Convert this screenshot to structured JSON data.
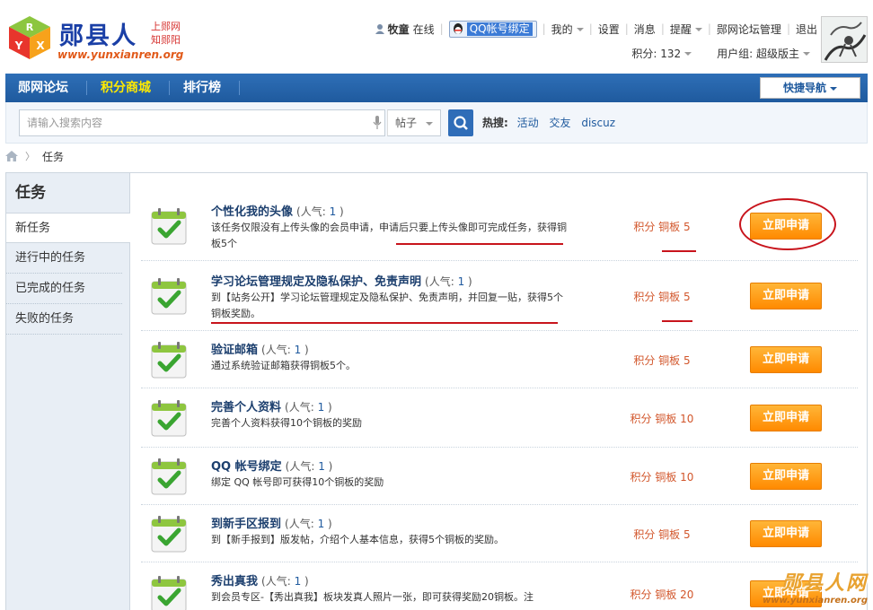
{
  "logo": {
    "title": "郧县人",
    "sub1": "上郧网",
    "sub2": "知郧阳",
    "url": "www.yunxianren.org",
    "cube": [
      "R",
      "Y",
      "X"
    ]
  },
  "user": {
    "name": "牧童",
    "status": "在线",
    "qq_bind": "QQ帐号绑定",
    "menu": [
      "我的",
      "设置",
      "消息",
      "提醒",
      "郧网论坛管理",
      "退出"
    ],
    "points_label": "积分: 132",
    "group_label": "用户组: 超级版主"
  },
  "nav": {
    "items": [
      "郧网论坛",
      "积分商城",
      "排行榜"
    ],
    "quick_nav": "快捷导航"
  },
  "search": {
    "placeholder": "请输入搜索内容",
    "type": "帖子",
    "hot_label": "热搜:",
    "hot_items": [
      "活动",
      "交友",
      "discuz"
    ]
  },
  "breadcrumb": {
    "current": "任务"
  },
  "sidebar": {
    "title": "任务",
    "items": [
      "新任务",
      "进行中的任务",
      "已完成的任务",
      "失败的任务"
    ]
  },
  "tasks": [
    {
      "name": "个性化我的头像",
      "pop_label": "(人气:",
      "pop": "1",
      "pop_end": ")",
      "desc": "该任务仅限没有上传头像的会员申请，申请后只要上传头像即可完成任务，获得铜板5个",
      "reward": "积分 铜板 5",
      "button": "立即申请"
    },
    {
      "name": "学习论坛管理规定及隐私保护、免责声明",
      "pop_label": "(人气:",
      "pop": "1",
      "pop_end": ")",
      "desc": "到【站务公开】学习论坛管理规定及隐私保护、免责声明，并回复一贴，获得5个铜板奖励。",
      "reward": "积分 铜板 5",
      "button": "立即申请"
    },
    {
      "name": "验证邮箱",
      "pop_label": "(人气:",
      "pop": "1",
      "pop_end": ")",
      "desc": "通过系统验证邮箱获得铜板5个。",
      "reward": "积分 铜板 5",
      "button": "立即申请"
    },
    {
      "name": "完善个人资料",
      "pop_label": "(人气:",
      "pop": "1",
      "pop_end": ")",
      "desc": "完善个人资料获得10个铜板的奖励",
      "reward": "积分 铜板 10",
      "button": "立即申请"
    },
    {
      "name": "QQ 帐号绑定",
      "pop_label": "(人气:",
      "pop": "1",
      "pop_end": ")",
      "desc": "绑定 QQ 帐号即可获得10个铜板的奖励",
      "reward": "积分 铜板 10",
      "button": "立即申请"
    },
    {
      "name": "到新手区报到",
      "pop_label": "(人气:",
      "pop": "1",
      "pop_end": ")",
      "desc": "到【新手报到】版发帖，介绍个人基本信息，获得5个铜板的奖励。",
      "reward": "积分 铜板 5",
      "button": "立即申请"
    },
    {
      "name": "秀出真我",
      "pop_label": "(人气:",
      "pop": "1",
      "pop_end": ")",
      "desc": "到会员专区-【秀出真我】板块发真人照片一张，即可获得奖励20铜板。注",
      "reward": "积分 铜板 20",
      "button": "立即申请"
    }
  ],
  "watermark": {
    "title": "郧县人网",
    "url": "www.yunxianren.org"
  },
  "colors": {
    "nav_blue": "#2e6fb7",
    "button_orange": "#ff9a00",
    "reward_red": "#d2562b",
    "annotation_red": "#c8141c"
  }
}
